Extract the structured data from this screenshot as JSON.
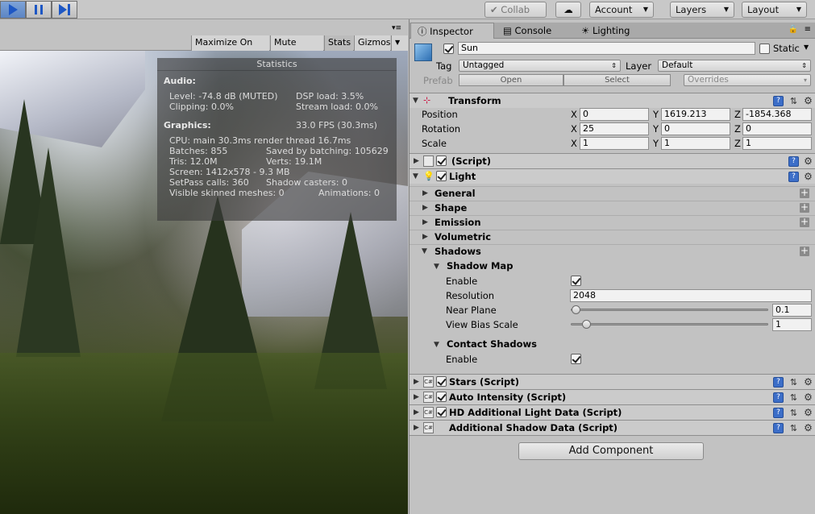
{
  "toolbar": {
    "collab_label": "Collab",
    "account_label": "Account",
    "layers_label": "Layers",
    "layout_label": "Layout"
  },
  "game_view": {
    "tabs": [
      "Maximize On Play",
      "Mute Audio",
      "Stats",
      "Gizmos"
    ],
    "stats": {
      "title": "Statistics",
      "audio_header": "Audio:",
      "level": "Level: -74.8 dB (MUTED)",
      "clipping": "Clipping: 0.0%",
      "dsp_load": "DSP load: 3.5%",
      "stream_load": "Stream load: 0.0%",
      "graphics_header": "Graphics:",
      "fps": "33.0 FPS (30.3ms)",
      "cpu": "CPU: main 30.3ms  render thread 16.7ms",
      "batches": "Batches: 855",
      "saved_batching": "Saved by batching: 105629",
      "tris": "Tris: 12.0M",
      "verts": "Verts: 19.1M",
      "screen": "Screen: 1412x578 - 9.3 MB",
      "setpass": "SetPass calls: 360",
      "shadow_casters": "Shadow casters: 0",
      "skinned": "Visible skinned meshes: 0",
      "animations": "Animations: 0"
    }
  },
  "inspector": {
    "tabs": {
      "inspector": "Inspector",
      "console": "Console",
      "lighting": "Lighting"
    },
    "object_name": "Sun",
    "static_label": "Static",
    "tag_label": "Tag",
    "tag_value": "Untagged",
    "layer_label": "Layer",
    "layer_value": "Default",
    "prefab_label": "Prefab",
    "prefab_open": "Open",
    "prefab_select": "Select",
    "prefab_overrides": "Overrides",
    "transform": {
      "title": "Transform",
      "position_label": "Position",
      "rotation_label": "Rotation",
      "scale_label": "Scale",
      "position": {
        "x": "0",
        "y": "1619.213",
        "z": "-1854.368"
      },
      "rotation": {
        "x": "25",
        "y": "0",
        "z": "0"
      },
      "scale": {
        "x": "1",
        "y": "1",
        "z": "1"
      },
      "axis_x": "X",
      "axis_y": "Y",
      "axis_z": "Z"
    },
    "script_component": "(Script)",
    "light": {
      "title": "Light",
      "sections": [
        "General",
        "Shape",
        "Emission",
        "Volumetric",
        "Shadows"
      ],
      "shadow_map_label": "Shadow Map",
      "enable_label": "Enable",
      "resolution_label": "Resolution",
      "resolution_value": "2048",
      "near_plane_label": "Near Plane",
      "near_plane_value": "0.1",
      "view_bias_label": "View Bias Scale",
      "view_bias_value": "1",
      "contact_shadows_label": "Contact Shadows",
      "contact_enable_label": "Enable"
    },
    "components": [
      "Stars (Script)",
      "Auto Intensity (Script)",
      "HD Additional Light Data (Script)",
      "Additional Shadow Data (Script)"
    ],
    "add_component": "Add Component"
  }
}
